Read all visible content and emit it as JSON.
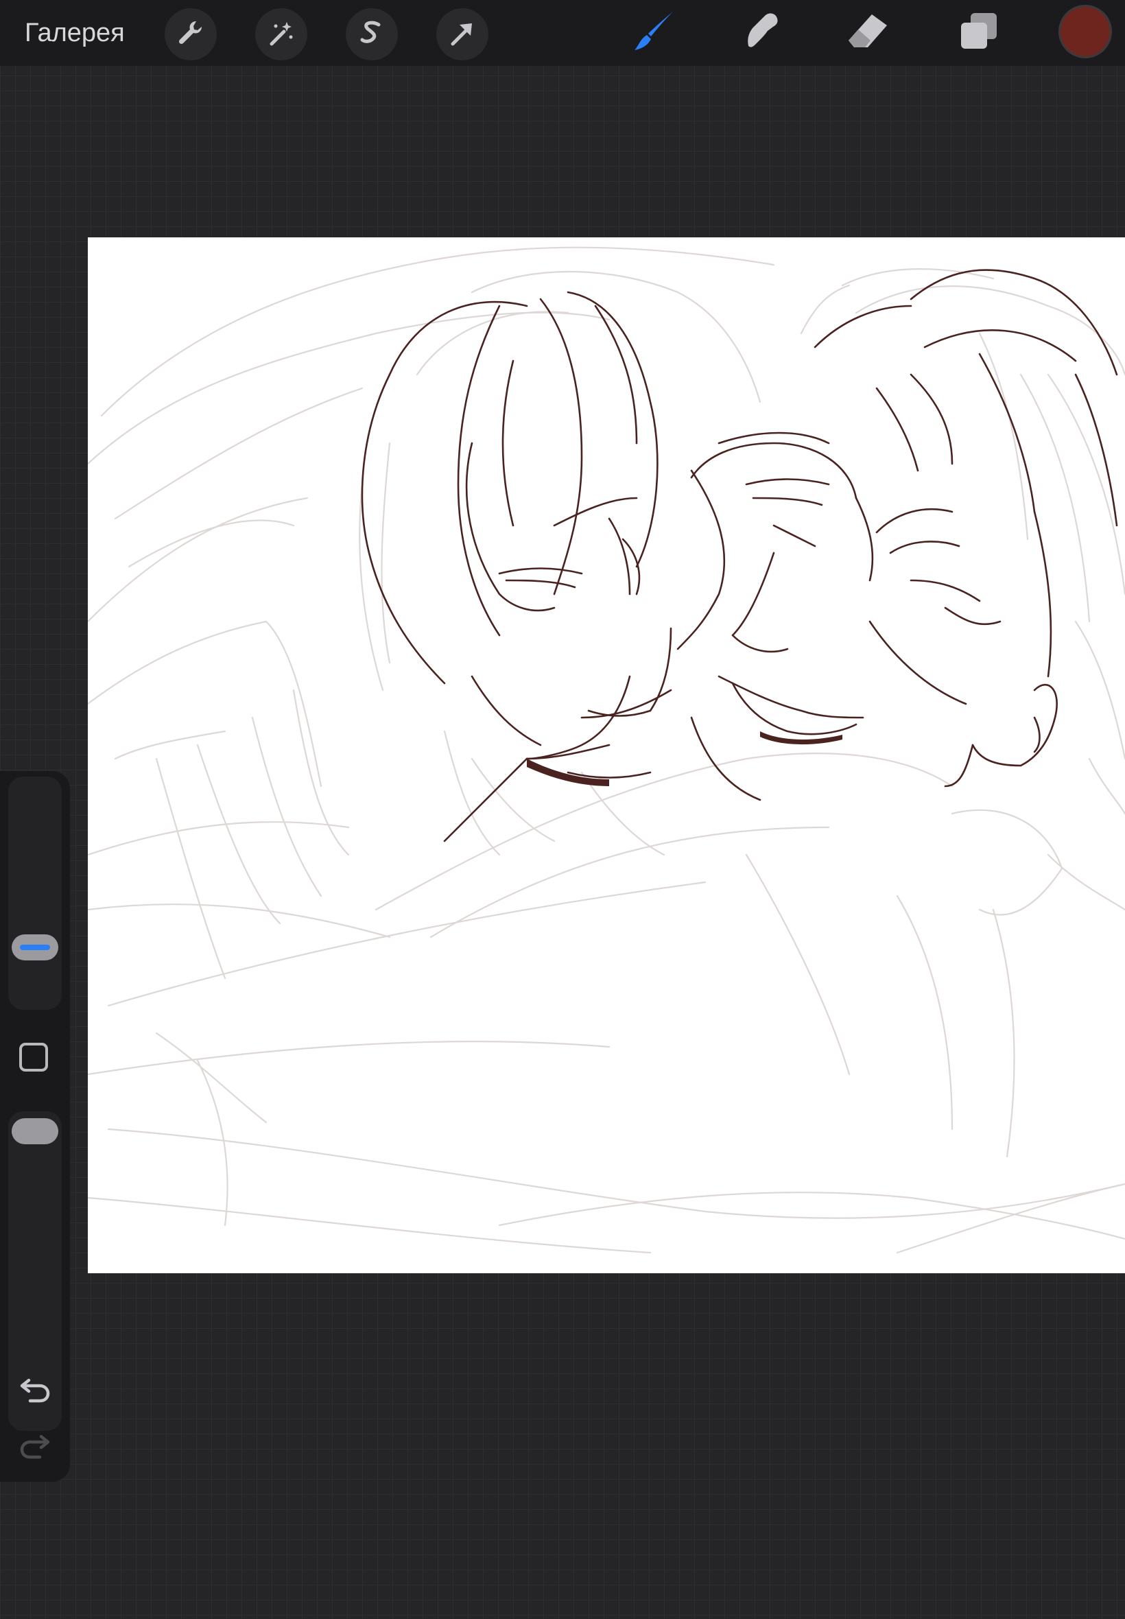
{
  "toolbar": {
    "gallery_label": "Галерея",
    "left_tools": [
      "wrench-icon",
      "magic-wand-icon",
      "selection-s-icon",
      "transform-arrow-icon"
    ],
    "right_tools": [
      "brush-icon",
      "smudge-icon",
      "eraser-icon",
      "layers-icon"
    ],
    "active_tool": "brush-icon",
    "current_color": "#6e251e"
  },
  "sidebar": {
    "brush_size_level": 0.78,
    "brush_opacity_level": 0.9
  },
  "colors": {
    "accent": "#2b7ff6",
    "background": "#252527",
    "toolbar": "#1b1b1d",
    "line_art": "#4a2320",
    "sketch": "#d9d2d0"
  }
}
